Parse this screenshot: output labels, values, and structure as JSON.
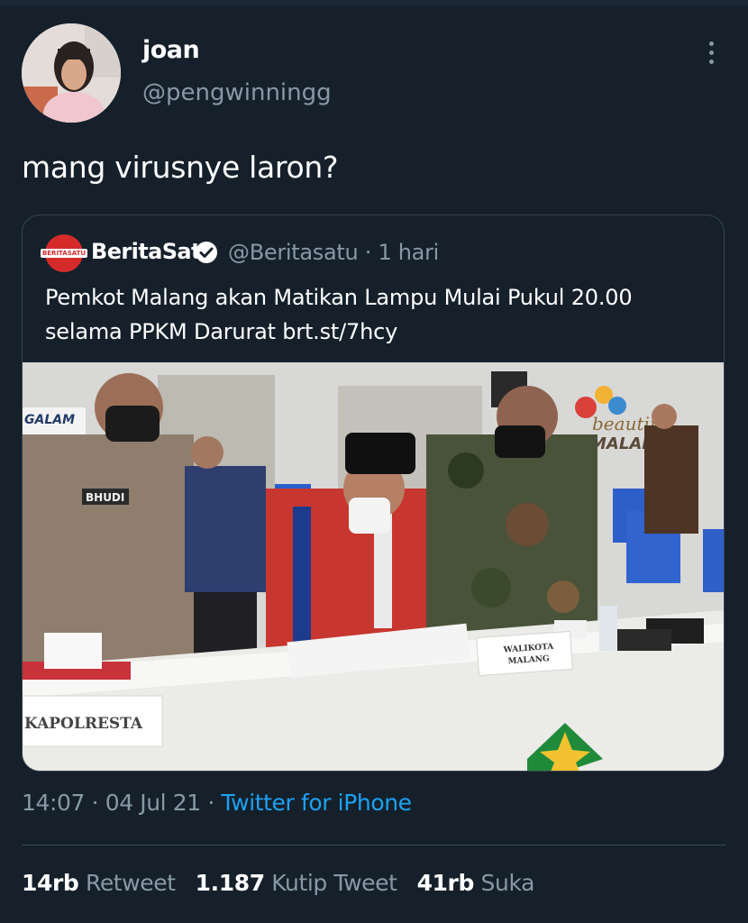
{
  "author": {
    "name": "joan",
    "handle": "@pengwinningg"
  },
  "tweet": {
    "text": "mang virusnye laron?"
  },
  "quoted": {
    "name": "BeritaSatu",
    "handle": "@Beritasatu",
    "separator": "·",
    "time": "1 hari",
    "text": "Pemkot Malang akan Matikan Lampu Mulai Pukul 20.00 selama PPKM Darurat brt.st/7hcy",
    "logo_text": "BERITASATU",
    "photo": {
      "wall_text_left": "GALAM",
      "wall_text_right_1": "beautiful",
      "wall_text_right_2": "MALANG",
      "badge_text": "BHUDI",
      "placard_left": "KAPOLRESTA",
      "placard_center_1": "WALIKOTA",
      "placard_center_2": "MALANG"
    }
  },
  "meta": {
    "time": "14:07",
    "date": "04 Jul 21",
    "separator": "·",
    "source": "Twitter for iPhone"
  },
  "stats": {
    "retweets_count": "14rb",
    "retweets_label": "Retweet",
    "quotes_count": "1.187",
    "quotes_label": "Kutip Tweet",
    "likes_count": "41rb",
    "likes_label": "Suka"
  },
  "colors": {
    "background": "#15202b",
    "secondary_text": "#8899a6",
    "link": "#1da1f2",
    "border": "#38444d"
  }
}
